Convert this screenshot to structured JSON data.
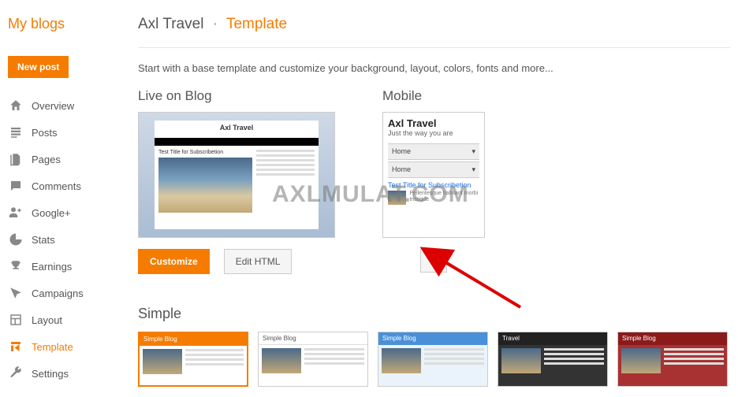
{
  "sidebar": {
    "title": "My blogs",
    "new_post": "New post",
    "items": [
      {
        "label": "Overview"
      },
      {
        "label": "Posts"
      },
      {
        "label": "Pages"
      },
      {
        "label": "Comments"
      },
      {
        "label": "Google+"
      },
      {
        "label": "Stats"
      },
      {
        "label": "Earnings"
      },
      {
        "label": "Campaigns"
      },
      {
        "label": "Layout"
      },
      {
        "label": "Template"
      },
      {
        "label": "Settings"
      }
    ]
  },
  "breadcrumb": {
    "blog": "Axl Travel",
    "page": "Template"
  },
  "intro": "Start with a base template and customize your background, layout, colors, fonts and more...",
  "preview": {
    "desktop_title": "Live on Blog",
    "mobile_title": "Mobile",
    "desktop_header": "Axl Travel",
    "desktop_post_title": "Test Title for Subscribetion",
    "mobile_header": "Axl Travel",
    "mobile_sub": "Just the way you are",
    "mobile_home": "Home",
    "mobile_link": "Test Title for Subscribetion",
    "mobile_excerpt": "Pellentesque habitant morbi tristique"
  },
  "buttons": {
    "customize": "Customize",
    "edit_html": "Edit HTML"
  },
  "gallery": {
    "title": "Simple",
    "thumbs": [
      {
        "label": "Simple Blog",
        "bg": "#f57c00",
        "body": "#fff",
        "text": "#fff"
      },
      {
        "label": "Simple Blog",
        "bg": "#fff",
        "body": "#fff",
        "text": "#555",
        "border": "1px solid #ddd"
      },
      {
        "label": "Simple Blog",
        "bg": "#4a90d9",
        "body": "#eaf3fb",
        "text": "#fff"
      },
      {
        "label": "Travel",
        "bg": "#222",
        "body": "#333",
        "text": "#fff"
      },
      {
        "label": "Simple Blog",
        "bg": "#8b1a1a",
        "body": "#a83232",
        "text": "#fff"
      }
    ]
  },
  "watermark": "AXLMULAT.COM"
}
